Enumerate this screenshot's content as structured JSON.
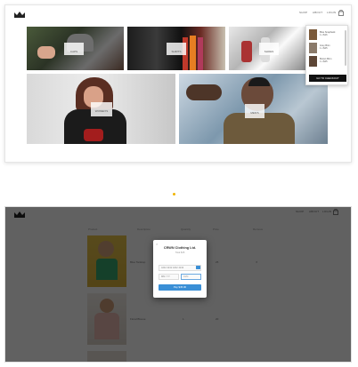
{
  "top": {
    "nav": {
      "shop": "SHOP",
      "about": "ABOUT",
      "login": "LOGIN"
    },
    "tiles": {
      "t1": "CAPS",
      "t2": "SHIRTS",
      "t3": "SHOES",
      "t4": "WOMEN'S",
      "t5": "MEN'S"
    },
    "cart": {
      "items": [
        {
          "name": "Blue Snapback",
          "price": "1 x $16"
        },
        {
          "name": "Grey Brim",
          "price": "1 x $25"
        },
        {
          "name": "Brown Brim",
          "price": "1 x $25"
        }
      ],
      "checkout": "GO TO CHECKOUT"
    }
  },
  "bottom": {
    "nav": {
      "shop": "SHOP",
      "about": "ABOUT",
      "login": "LOGIN"
    },
    "headers": {
      "product": "Product",
      "description": "Description",
      "quantity": "Quantity",
      "price": "Price",
      "remove": "Remove"
    },
    "rows": [
      {
        "desc": "Blue Tanktop",
        "qty": "1",
        "price": "25"
      },
      {
        "desc": "Floral Blouse",
        "qty": "1",
        "price": "20"
      }
    ],
    "modal": {
      "title": "CRWN Clothing Ltd.",
      "subtitle": "Total $45",
      "card": "4242 4242 4242 4242",
      "expiry": "MM / YY",
      "cvc": "CVC",
      "pay": "Pay $45.00"
    }
  }
}
